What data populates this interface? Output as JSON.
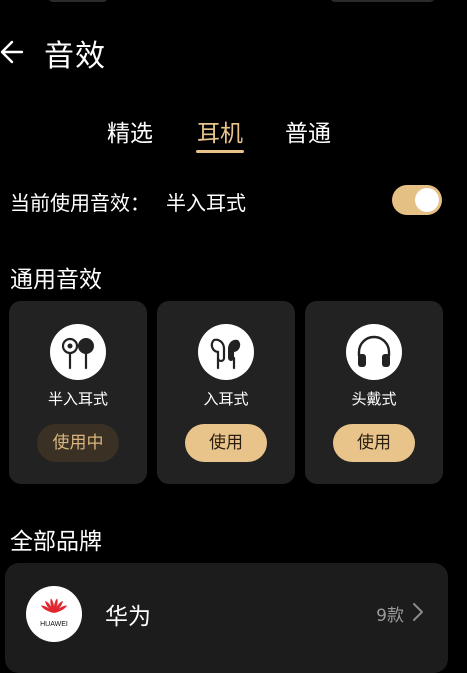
{
  "header": {
    "title": "音效"
  },
  "tabs": [
    {
      "label": "精选",
      "active": false
    },
    {
      "label": "耳机",
      "active": true
    },
    {
      "label": "普通",
      "active": false
    }
  ],
  "current": {
    "label": "当前使用音效：",
    "value": "半入耳式",
    "enabled": true
  },
  "general_section": {
    "title": "通用音效"
  },
  "cards": [
    {
      "name": "半入耳式",
      "icon": "semi-in-ear-earphone-icon",
      "button": "使用中",
      "in_use": true
    },
    {
      "name": "入耳式",
      "icon": "in-ear-earbuds-icon",
      "button": "使用",
      "in_use": false
    },
    {
      "name": "头戴式",
      "icon": "headphones-icon",
      "button": "使用",
      "in_use": false
    }
  ],
  "brands_section": {
    "title": "全部品牌"
  },
  "brands": [
    {
      "name": "华为",
      "count": "9款",
      "logo_text": "HUAWEI"
    }
  ],
  "colors": {
    "accent": "#e8c48b",
    "card_bg": "#222222",
    "page_bg": "#000000",
    "huawei_red": "#e0262f"
  }
}
